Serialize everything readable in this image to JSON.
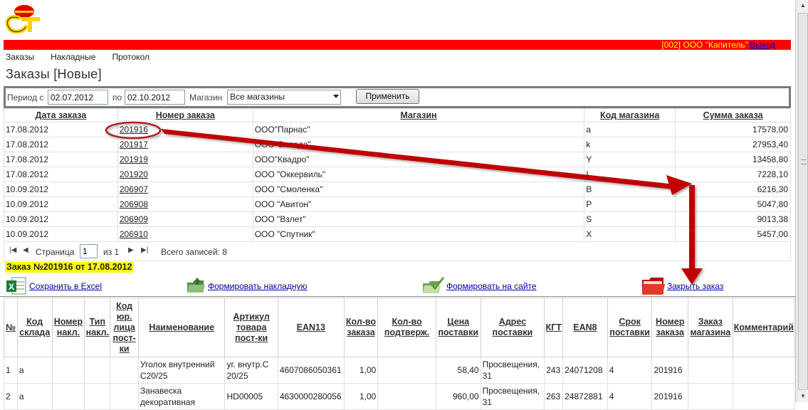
{
  "header": {
    "user": "[002] ООО \"Капитель\"",
    "logout": "Выход"
  },
  "menu": [
    "Заказы",
    "Накладные",
    "Протокол"
  ],
  "page_title": "Заказы [Новые]",
  "filter": {
    "period_label": "Период с",
    "date_from": "02.07.2012",
    "to_label": "по",
    "date_to": "02.10.2012",
    "store_label": "Магазин",
    "store_value": "Все магазины",
    "apply_label": "Применить"
  },
  "orders": {
    "headers": [
      "Дата заказа",
      "Номер заказа",
      "Магазин",
      "Код магазина",
      "Сумма заказа"
    ],
    "rows": [
      {
        "date": "17.08.2012",
        "number": "201916",
        "store": "ООО\"Парнас\"",
        "code": "a",
        "sum": "17578,00"
      },
      {
        "date": "17.08.2012",
        "number": "201917",
        "store": "ООО\"Эллада\"",
        "code": "k",
        "sum": "27953,40"
      },
      {
        "date": "17.08.2012",
        "number": "201919",
        "store": "ООО\"Квадро\"",
        "code": "Y",
        "sum": "13458,80"
      },
      {
        "date": "17.08.2012",
        "number": "201920",
        "store": "ООО \"Оккервиль\"",
        "code": "I",
        "sum": "7228,10"
      },
      {
        "date": "10.09.2012",
        "number": "206907",
        "store": "ООО \"Смоленка\"",
        "code": "B",
        "sum": "6216,30"
      },
      {
        "date": "10.09.2012",
        "number": "206908",
        "store": "ООО \"Авитон\"",
        "code": "P",
        "sum": "5047,80"
      },
      {
        "date": "10.09.2012",
        "number": "206909",
        "store": "ООО \"Взлет\"",
        "code": "S",
        "sum": "9013,38"
      },
      {
        "date": "10.09.2012",
        "number": "206910",
        "store": "ООО \"Спутник\"",
        "code": "X",
        "sum": "5457,00"
      }
    ]
  },
  "pager": {
    "page_label": "Страница",
    "page": "1",
    "of_label": "из 1",
    "total": "Всего записей: 8"
  },
  "order_heading": "Заказ №201916 от 17.08.2012",
  "actions": {
    "excel": "Сохранить в Excel",
    "invoice": "Формировать накладную",
    "site": "Формировать на сайте",
    "close": "Закрыть заказ"
  },
  "details": {
    "headers": [
      "№",
      "Код склада",
      "Номер накл.",
      "Тип накл.",
      "Код юр. лица пост-ки",
      "Наименование",
      "Артикул товара пост-ки",
      "EAN13",
      "Кол-во заказа",
      "Кол-во подтверж.",
      "Цена поставки",
      "Адрес поставки",
      "КГТ",
      "EAN8",
      "Срок поставки",
      "Номер заказа",
      "Заказ магазина",
      "Комментарий"
    ],
    "rows": [
      {
        "n": "1",
        "wh": "a",
        "inv": "",
        "type": "",
        "legal": "",
        "name": "Уголок внутренний С20/25",
        "art": "уг. внутр.С 20/25",
        "ean13": "4607086050361",
        "qty": "1,00",
        "conf": "",
        "price": "58,40",
        "addr": "Просвещения, 31",
        "kgt": "243",
        "ean8": "24071208",
        "term": "4",
        "order": "201916",
        "shop": "",
        "comment": ""
      },
      {
        "n": "2",
        "wh": "a",
        "inv": "",
        "type": "",
        "legal": "",
        "name": "Занавеска декоративная",
        "art": "HD00005",
        "ean13": "4630000280056",
        "qty": "1,00",
        "conf": "",
        "price": "960,00",
        "addr": "Просвещения, 31",
        "kgt": "263",
        "ean8": "24872881",
        "term": "4",
        "order": "201916",
        "shop": "",
        "comment": ""
      }
    ]
  },
  "colors": {
    "header_bar": "#ff0000",
    "user_text": "#ffff00",
    "order_highlight": "#ffff00",
    "annotation": "#c00000"
  }
}
